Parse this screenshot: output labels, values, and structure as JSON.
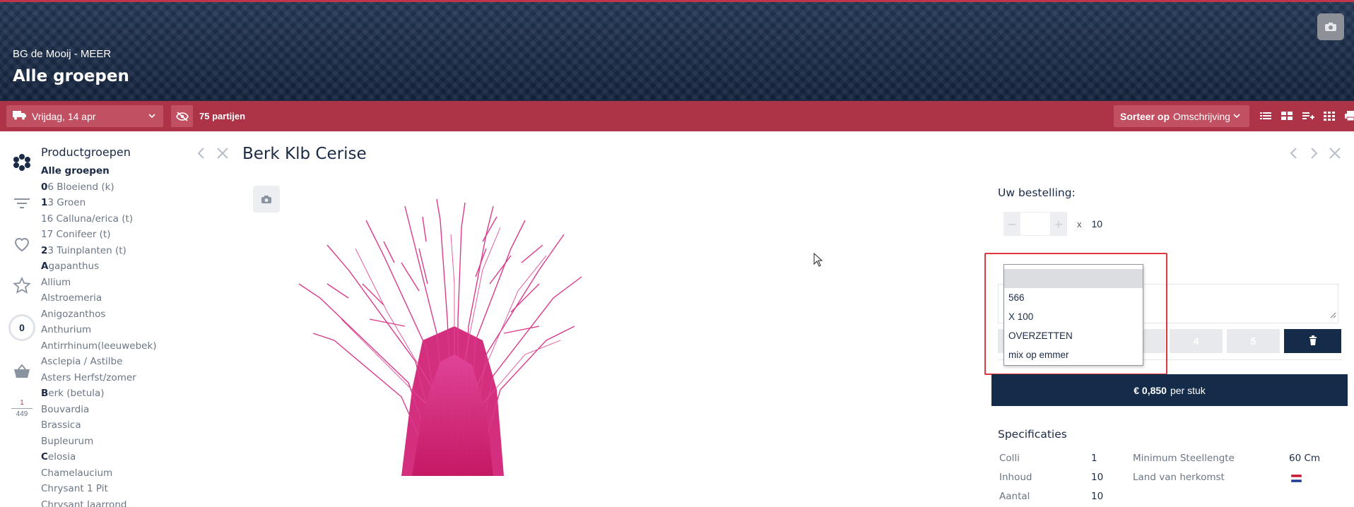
{
  "header": {
    "subtitle": "BG de Mooij - MEER",
    "title": "Alle groepen",
    "camera_icon": "camera-icon"
  },
  "toolbar": {
    "date": "Vrijdag, 14 apr",
    "partijen": "75 partijen",
    "sort_prefix": "Sorteer op",
    "sort_value": "Omschrijving",
    "view_icons": [
      "list-view-icon",
      "grid-view-icon",
      "add-list-icon",
      "table-view-icon",
      "print-icon"
    ]
  },
  "rail": {
    "counter": "0",
    "fraction_num": "1",
    "fraction_den": "449"
  },
  "groups": {
    "title": "Productgroepen",
    "items": [
      {
        "bold": "",
        "rest": "Alle groepen",
        "active": true
      },
      {
        "bold": "0",
        "rest": "6 Bloeiend (k)"
      },
      {
        "bold": "1",
        "rest": "3 Groen"
      },
      {
        "bold": "",
        "rest": "16 Calluna/erica (t)"
      },
      {
        "bold": "",
        "rest": "17 Conifeer (t)"
      },
      {
        "bold": "2",
        "rest": "3 Tuinplanten (t)"
      },
      {
        "bold": "A",
        "rest": "gapanthus"
      },
      {
        "bold": "",
        "rest": "Allium"
      },
      {
        "bold": "",
        "rest": "Alstroemeria"
      },
      {
        "bold": "",
        "rest": "Anigozanthos"
      },
      {
        "bold": "",
        "rest": "Anthurium"
      },
      {
        "bold": "",
        "rest": "Antirrhinum(leeuwebek)"
      },
      {
        "bold": "",
        "rest": "Asclepia / Astilbe"
      },
      {
        "bold": "",
        "rest": "Asters Herfst/zomer"
      },
      {
        "bold": "B",
        "rest": "erk (betula)"
      },
      {
        "bold": "",
        "rest": "Bouvardia"
      },
      {
        "bold": "",
        "rest": "Brassica"
      },
      {
        "bold": "",
        "rest": "Bupleurum"
      },
      {
        "bold": "C",
        "rest": "elosia"
      },
      {
        "bold": "",
        "rest": "Chamelaucium"
      },
      {
        "bold": "",
        "rest": "Chrysant 1 Pit"
      },
      {
        "bold": "",
        "rest": "Chrysant Jaarrond"
      }
    ]
  },
  "product": {
    "title": "Berk Klb Cerise"
  },
  "order": {
    "label": "Uw bestelling:",
    "qty_minus": "−",
    "qty_plus": "+",
    "qty_value": "",
    "times": "x",
    "multiplier": "10",
    "dropdown_options": [
      "",
      "566",
      "X 100",
      "OVERZETTEN",
      "mix op emmer"
    ],
    "buttons": [
      "4",
      "5"
    ],
    "price": "€ 0,850",
    "price_suffix": "per stuk"
  },
  "specs": {
    "title": "Specificaties",
    "left": [
      {
        "label": "Colli",
        "value": "1"
      },
      {
        "label": "Inhoud",
        "value": "10"
      },
      {
        "label": "Aantal",
        "value": "10"
      }
    ],
    "right": [
      {
        "label": "Minimum Steellengte",
        "value": "60 Cm"
      },
      {
        "label": "Land van herkomst",
        "value": ""
      }
    ]
  }
}
